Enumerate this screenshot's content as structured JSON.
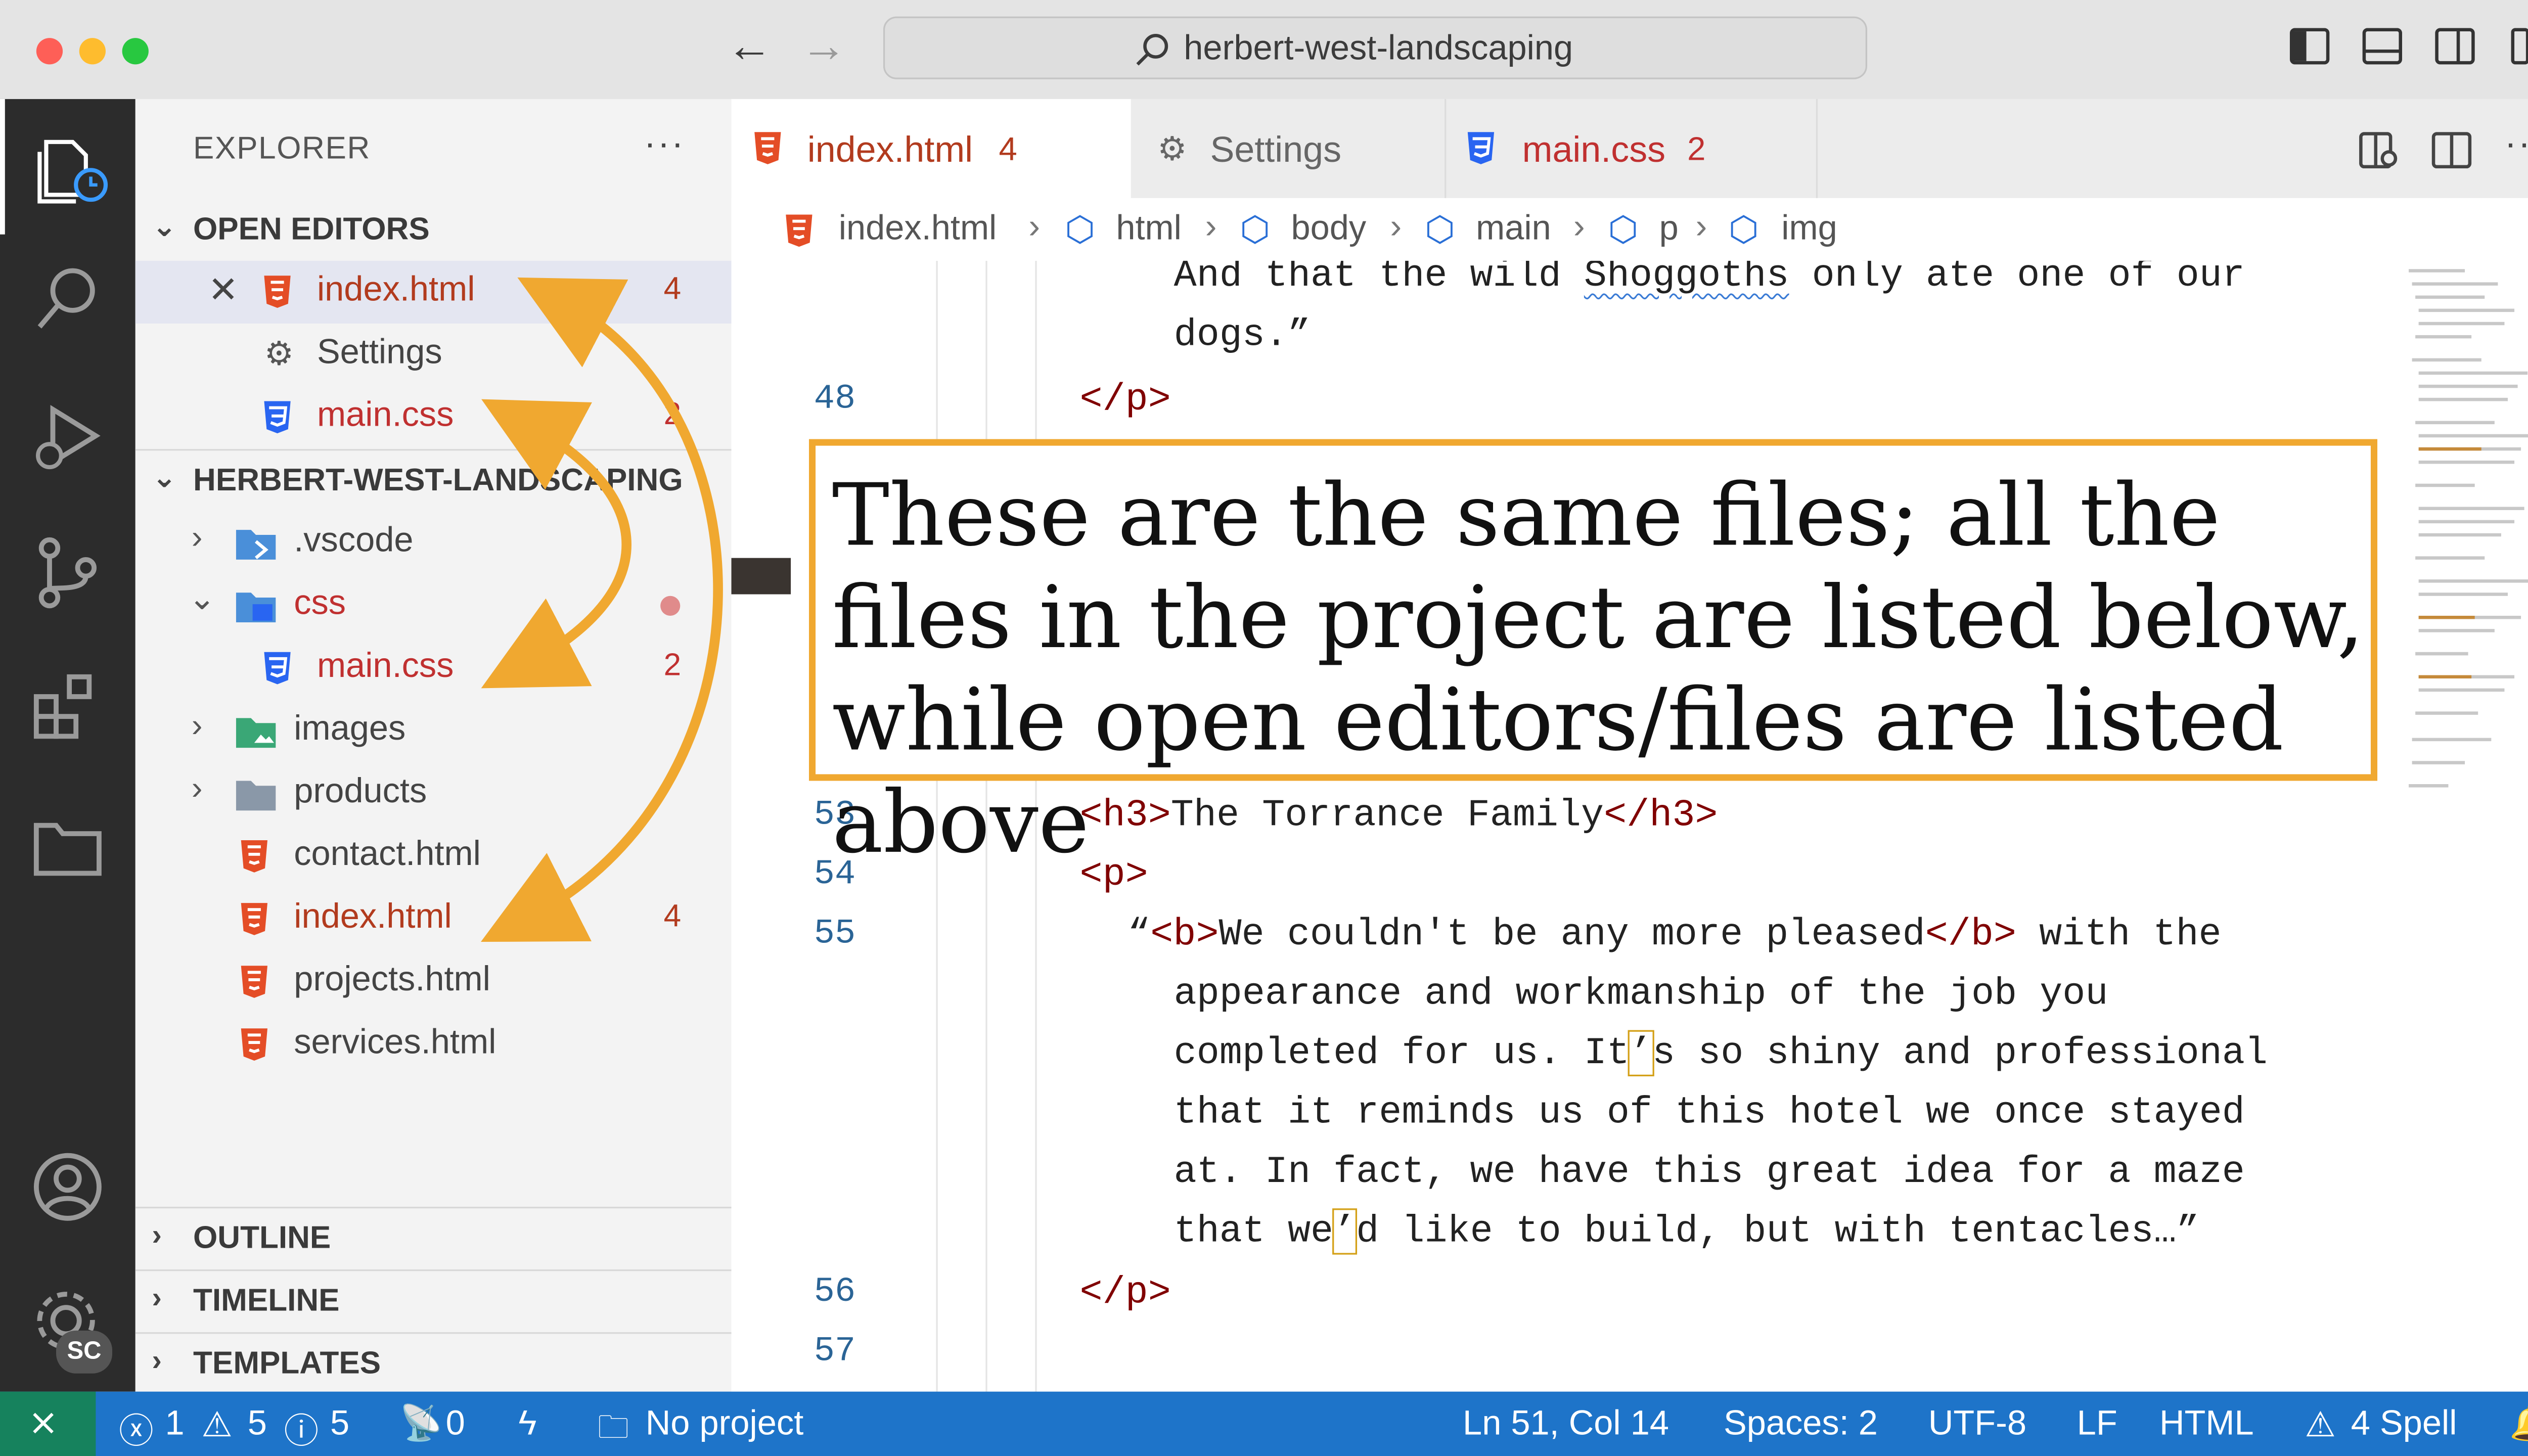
{
  "window": {
    "command_center": "herbert-west-landscaping"
  },
  "sidebar": {
    "title": "EXPLORER",
    "more": "···",
    "open_editors": {
      "header": "OPEN EDITORS",
      "items": [
        {
          "name": "index.html",
          "badge": "4",
          "icon": "html5-file-icon"
        },
        {
          "name": "Settings",
          "badge": "",
          "icon": "settings-sliders-icon"
        },
        {
          "name": "main.css",
          "badge": "2",
          "icon": "css3-file-icon"
        }
      ]
    },
    "project": {
      "header": "HERBERT-WEST-LANDSCAPING",
      "items": [
        {
          "name": ".vscode",
          "icon": "vscode-folder-icon"
        },
        {
          "name": "css",
          "icon": "css-folder-icon"
        },
        {
          "name": "main.css",
          "badge": "2",
          "icon": "css3-file-icon"
        },
        {
          "name": "images",
          "icon": "images-folder-icon"
        },
        {
          "name": "products",
          "icon": "folder-icon"
        },
        {
          "name": "contact.html",
          "icon": "html5-file-icon"
        },
        {
          "name": "index.html",
          "badge": "4",
          "icon": "html5-file-icon"
        },
        {
          "name": "projects.html",
          "icon": "html5-file-icon"
        },
        {
          "name": "services.html",
          "icon": "html5-file-icon"
        }
      ]
    },
    "bottom_sections": [
      "OUTLINE",
      "TIMELINE",
      "TEMPLATES"
    ]
  },
  "tabs": [
    {
      "label": "index.html",
      "badge": "4"
    },
    {
      "label": "Settings"
    },
    {
      "label": "main.css",
      "badge": "2"
    }
  ],
  "breadcrumb": [
    "index.html",
    "html",
    "body",
    "main",
    "p",
    "img"
  ],
  "editor": {
    "line_numbers": [
      "48",
      "53",
      "54",
      "55",
      "56",
      "57"
    ],
    "top_line_1_pre": "And that the wild ",
    "top_line_1_word": "Shoggoths",
    "top_line_1_post": " only ate one of our",
    "top_line_2": "dogs.”",
    "l48": "</p>",
    "l53_open": "<h3>",
    "l53_text": "The Torrance Family",
    "l53_close": "</h3>",
    "l54": "<p>",
    "l55_quote": "“",
    "l55_b_open": "<b>",
    "l55_b_text": "We couldn't be any more pleased",
    "l55_b_close": "</b>",
    "l55_rest": " with the",
    "wrap_1": "appearance and workmanship of the job you",
    "wrap_2_pre": "completed for us. It",
    "wrap_2_mark": "’",
    "wrap_2_post": "s so shiny and professional",
    "wrap_3": "that it reminds us of this hotel we once stayed",
    "wrap_4": "at. In fact, we have this great idea for a maze",
    "wrap_5_pre": "that we",
    "wrap_5_mark": "’",
    "wrap_5_post": "d like to build, but with tentacles…”",
    "l56": "</p>"
  },
  "annotation": "These are the same files; all the files in the project are listed below, while open editors/files are listed above",
  "status_bar": {
    "errors": "1",
    "warnings": "5",
    "info": "5",
    "ports": "0",
    "project": "No project",
    "position": "Ln 51, Col 14",
    "spaces": "Spaces: 2",
    "encoding": "UTF-8",
    "eol": "LF",
    "language": "HTML",
    "spell": "4 Spell"
  },
  "accounts_badge": "SC",
  "colors": {
    "accent_orange": "#f0a830",
    "status_blue": "#1e74c9",
    "remote_green": "#16825d",
    "html_red": "#e44d26",
    "css_blue": "#2965f1"
  }
}
